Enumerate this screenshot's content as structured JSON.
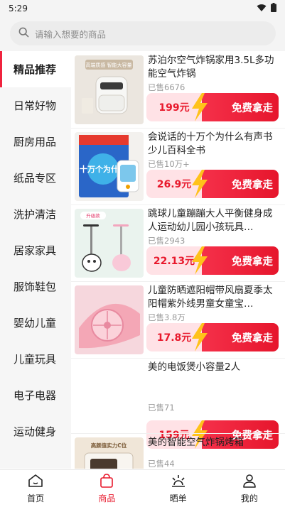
{
  "status": {
    "time": "5:29"
  },
  "search": {
    "placeholder": "请输入想要的商品"
  },
  "sidebar": {
    "items": [
      {
        "label": "精品推荐",
        "active": true
      },
      {
        "label": "日常好物"
      },
      {
        "label": "厨房用品"
      },
      {
        "label": "纸品专区"
      },
      {
        "label": "洗护清洁"
      },
      {
        "label": "居家家具"
      },
      {
        "label": "服饰鞋包"
      },
      {
        "label": "婴幼儿童"
      },
      {
        "label": "儿童玩具"
      },
      {
        "label": "电子电器"
      },
      {
        "label": "运动健身"
      }
    ]
  },
  "products": [
    {
      "title": "苏泊尔空气炸锅家用3.5L多功能空气炸锅",
      "sold": "已售6676",
      "price": "199元",
      "action": "免费拿走",
      "thumb_text": "高端质感 智能大容量"
    },
    {
      "title": "会说话的十万个为什么有声书少儿百科全书",
      "sold": "已售10万+",
      "price": "26.9元",
      "action": "免费拿走",
      "thumb_text": "十万个为什么"
    },
    {
      "title": "跳球儿童蹦蹦大人平衡健身成人运动幼儿园小孩玩具…",
      "sold": "已售2943",
      "price": "22.13元",
      "action": "免费拿走",
      "thumb_text": "升级款"
    },
    {
      "title": "儿童防晒遮阳帽带风扇夏季太阳帽紫外线男童女童宝…",
      "sold": "已售3.8万",
      "price": "17.8元",
      "action": "免费拿走",
      "thumb_text": ""
    },
    {
      "title": "美的电饭煲小容量2人",
      "sold": "已售71",
      "price": "159元",
      "action": "免费拿走",
      "thumb_text": ""
    },
    {
      "title": "美的智能空气炸锅烤箱",
      "sold": "已售44",
      "price": "",
      "action": "",
      "thumb_text": "高颜值实力C位"
    }
  ],
  "tabbar": {
    "items": [
      {
        "label": "首页",
        "icon": "home-icon"
      },
      {
        "label": "商品",
        "icon": "bag-icon",
        "active": true
      },
      {
        "label": "晒单",
        "icon": "sun-icon"
      },
      {
        "label": "我的",
        "icon": "user-icon"
      }
    ]
  },
  "colors": {
    "accent": "#e8192c",
    "price_bg": "#ffe2e6"
  }
}
